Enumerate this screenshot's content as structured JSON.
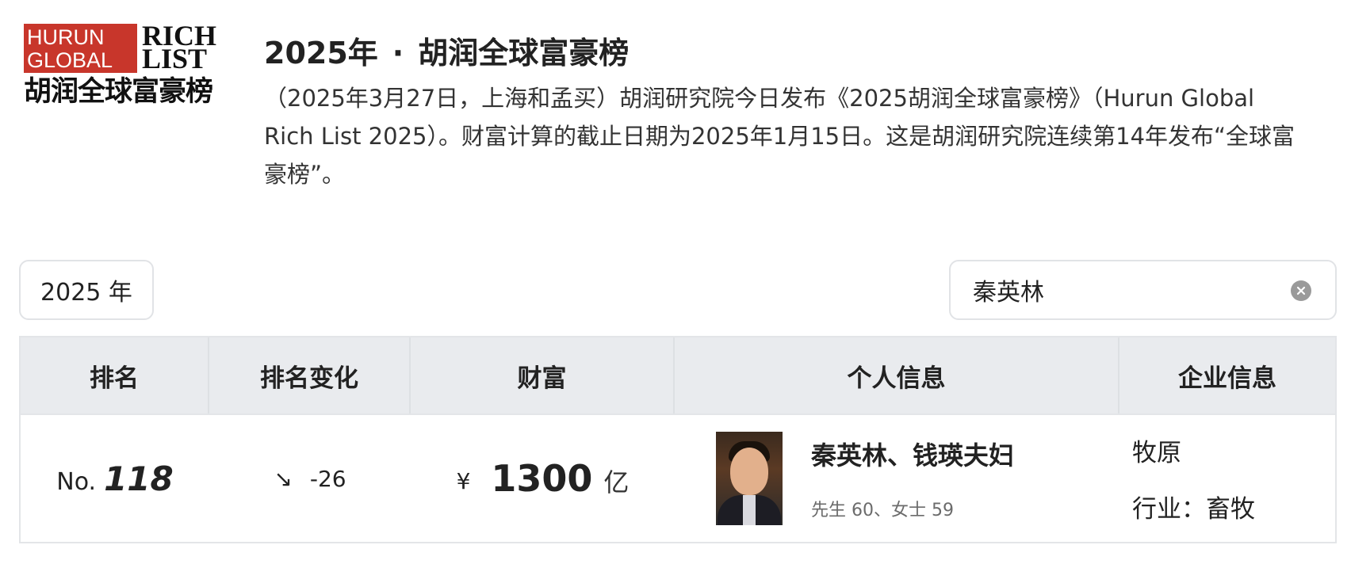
{
  "logo": {
    "red_line1": "HURUN",
    "red_line2": "GLOBAL",
    "black_line1": "RICH",
    "black_line2": "LIST",
    "cn": "胡润全球富豪榜"
  },
  "header": {
    "year": "2025年",
    "separator": "·",
    "list_name": "胡润全球富豪榜",
    "description": "（2025年3月27日，上海和孟买）胡润研究院今日发布《2025胡润全球富豪榜》（Hurun Global Rich List 2025）。财富计算的截止日期为2025年1月15日。这是胡润研究院连续第14年发布“全球富豪榜”。"
  },
  "controls": {
    "year_select": "2025 年",
    "search_value": "秦英林",
    "clear_icon": "clear-icon"
  },
  "table": {
    "headers": [
      "排名",
      "排名变化",
      "财富",
      "个人信息",
      "企业信息"
    ],
    "rows": [
      {
        "rank_prefix": "No.",
        "rank": "118",
        "change_icon": "↘",
        "change": "-26",
        "currency": "¥",
        "wealth": "1300",
        "wealth_unit": "亿",
        "name": "秦英林、钱瑛夫妇",
        "ages": "先生  60、女士  59",
        "company": "牧原",
        "industry": "行业：畜牧"
      }
    ]
  },
  "colors": {
    "logo_red": "#c8362b",
    "header_bg": "#e9ebee",
    "border": "#e3e5e8"
  }
}
